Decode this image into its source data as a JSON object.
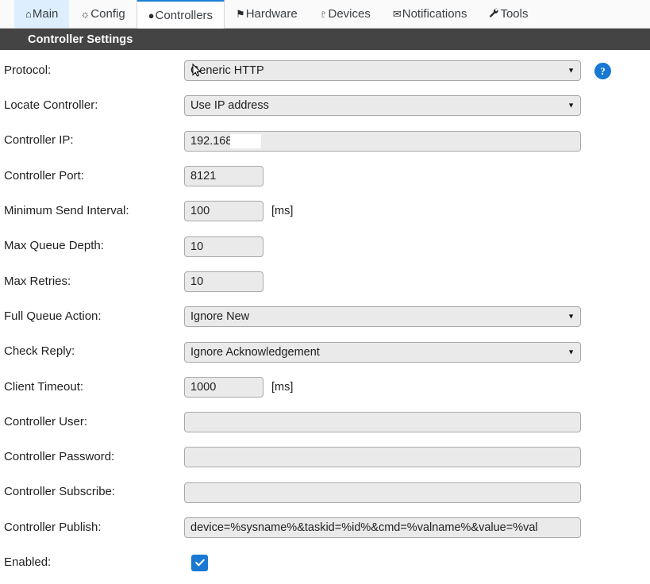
{
  "tabs": [
    {
      "label": "Main",
      "icon": "home-icon",
      "glyph": "⌂",
      "state": "highlight"
    },
    {
      "label": "Config",
      "icon": "gear-icon",
      "glyph": "☼",
      "state": "normal"
    },
    {
      "label": "Controllers",
      "icon": "speech-bubble-icon",
      "glyph": "●",
      "state": "active"
    },
    {
      "label": "Hardware",
      "icon": "pushpin-icon",
      "glyph": "⚑",
      "state": "normal"
    },
    {
      "label": "Devices",
      "icon": "plug-icon",
      "glyph": "♇",
      "state": "normal"
    },
    {
      "label": "Notifications",
      "icon": "envelope-icon",
      "glyph": "✉",
      "state": "normal"
    },
    {
      "label": "Tools",
      "icon": "wrench-icon",
      "glyph": "ὒ7",
      "state": "normal"
    }
  ],
  "section": {
    "title": "Controller Settings"
  },
  "fields": {
    "protocol": {
      "label": "Protocol:",
      "value": "Generic HTTP",
      "type": "select"
    },
    "locate_controller": {
      "label": "Locate Controller:",
      "value": "Use IP address",
      "type": "select"
    },
    "controller_ip": {
      "label": "Controller IP:",
      "value": "192.168",
      "type": "text"
    },
    "controller_port": {
      "label": "Controller Port:",
      "value": "8121",
      "type": "text"
    },
    "min_send_interval": {
      "label": "Minimum Send Interval:",
      "value": "100",
      "unit": "[ms]",
      "type": "text"
    },
    "max_queue_depth": {
      "label": "Max Queue Depth:",
      "value": "10",
      "type": "text"
    },
    "max_retries": {
      "label": "Max Retries:",
      "value": "10",
      "type": "text"
    },
    "full_queue_action": {
      "label": "Full Queue Action:",
      "value": "Ignore New",
      "type": "select"
    },
    "check_reply": {
      "label": "Check Reply:",
      "value": "Ignore Acknowledgement",
      "type": "select"
    },
    "client_timeout": {
      "label": "Client Timeout:",
      "value": "1000",
      "unit": "[ms]",
      "type": "text"
    },
    "controller_user": {
      "label": "Controller User:",
      "value": "",
      "type": "text"
    },
    "controller_password": {
      "label": "Controller Password:",
      "value": "",
      "type": "password"
    },
    "controller_subscribe": {
      "label": "Controller Subscribe:",
      "value": "",
      "type": "text"
    },
    "controller_publish": {
      "label": "Controller Publish:",
      "value": "device=%sysname%&taskid=%id%&cmd=%valname%&value=%val",
      "type": "text"
    },
    "enabled": {
      "label": "Enabled:",
      "value": "checked",
      "type": "checkbox"
    }
  },
  "help": {
    "glyph": "?"
  },
  "colors": {
    "accent": "#1878d2",
    "header_bar": "#444444",
    "active_tab_border": "#1a7fd4",
    "tab_highlight": "#ddeeff",
    "field_bg": "#eaeaea",
    "field_border": "#a9a9a9"
  }
}
